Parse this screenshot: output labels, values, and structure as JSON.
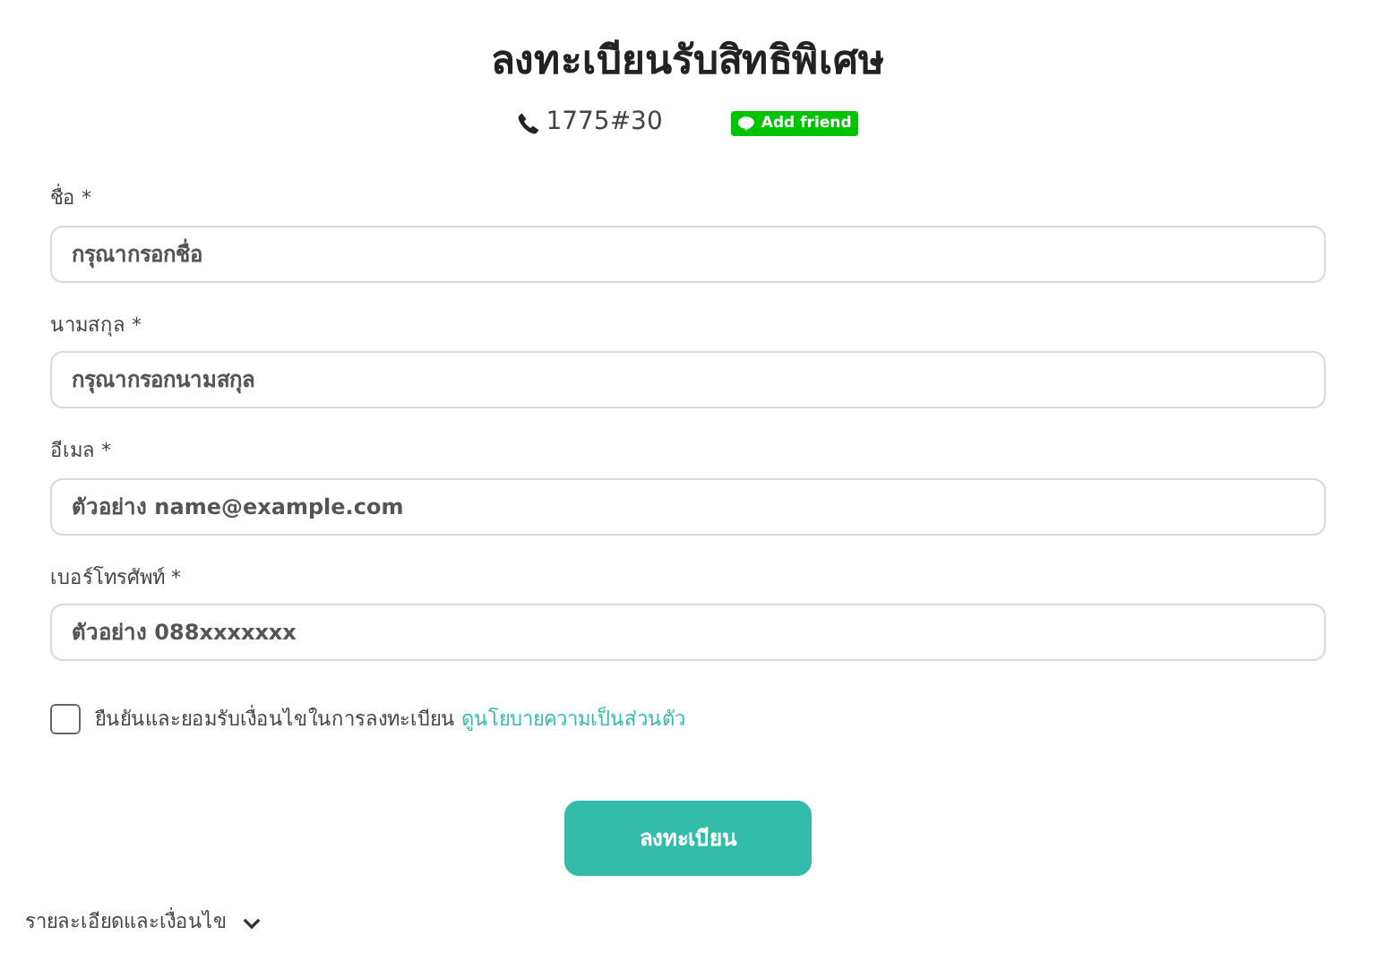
{
  "title": "ลงทะเบียนรับสิทธิพิเศษ",
  "phone": "1775#30",
  "add_friend": "Add friend",
  "fields": [
    {
      "label": "ชื่อ *",
      "placeholder": "กรุณากรอกชื่อ"
    },
    {
      "label": "นามสกุล *",
      "placeholder": "กรุณากรอกนามสกุล"
    },
    {
      "label": "อีเมล *",
      "placeholder": "ตัวอย่าง name@example.com"
    },
    {
      "label": "เบอร์โทรศัพท์ *",
      "placeholder": "ตัวอย่าง 088xxxxxxx"
    }
  ],
  "consent": {
    "checked": false,
    "text": "ยืนยันและยอมรับเงื่อนไขในการลงทะเบียน",
    "link": "ดูนโยบายความเป็นส่วนตัว"
  },
  "submit_button": "ลงทะเบียน",
  "details": {
    "label": "รายละเอียดและเงื่อนไข",
    "expanded": false
  }
}
